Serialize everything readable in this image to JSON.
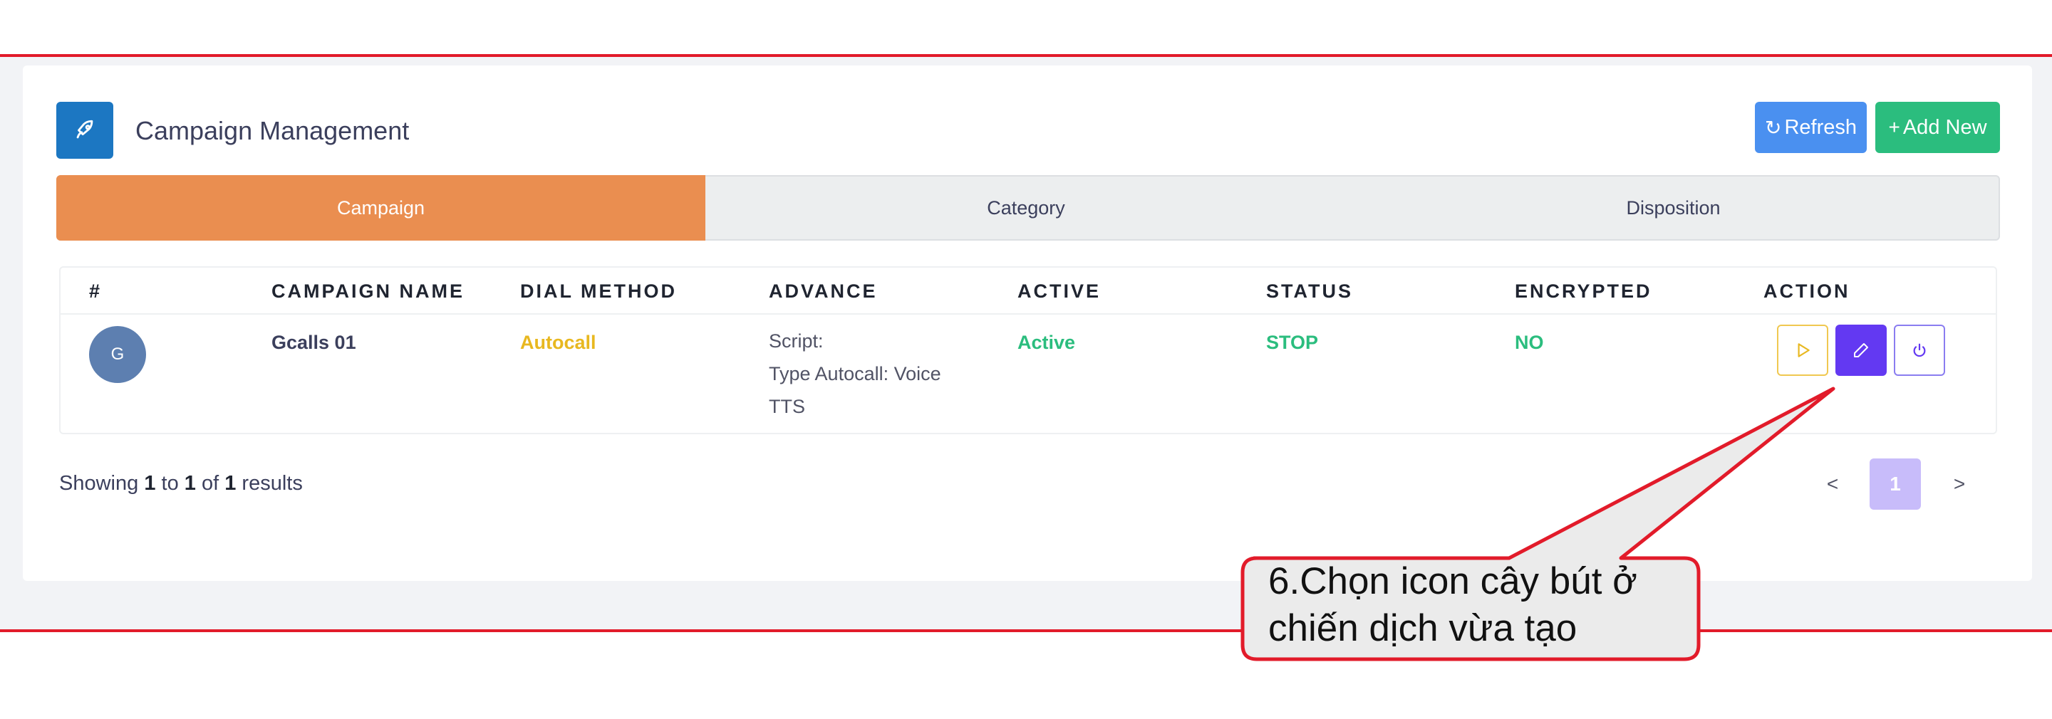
{
  "header": {
    "title": "Campaign Management",
    "title_icon": "rocket-icon",
    "refresh_label": "Refresh",
    "refresh_icon": "refresh-icon",
    "add_new_label": "Add New",
    "add_new_icon": "plus-icon"
  },
  "tabs": [
    {
      "label": "Campaign",
      "active": true
    },
    {
      "label": "Category",
      "active": false
    },
    {
      "label": "Disposition",
      "active": false
    }
  ],
  "table": {
    "columns": [
      "#",
      "CAMPAIGN NAME",
      "DIAL METHOD",
      "ADVANCE",
      "ACTIVE",
      "STATUS",
      "ENCRYPTED",
      "ACTION"
    ],
    "rows": [
      {
        "avatar": "G",
        "name": "Gcalls 01",
        "dial_method": "Autocall",
        "advance": [
          "Script:",
          "Type Autocall: Voice",
          "TTS"
        ],
        "active": "Active",
        "status": "STOP",
        "encrypted": "NO",
        "actions": [
          "play-icon",
          "pencil-icon",
          "power-icon"
        ]
      }
    ]
  },
  "pagination": {
    "prefix": "Showing",
    "from": "1",
    "to_word": "to",
    "to": "1",
    "of_word": "of",
    "total": "1",
    "suffix": "results",
    "prev": "<",
    "current": "1",
    "next": ">"
  },
  "callout": {
    "text": "6.Chọn icon cây bút ở\nchiến dịch vừa tạo"
  },
  "colors": {
    "accent_tab": "#ea8e50",
    "refresh": "#4a90f0",
    "add_new": "#2bbd7e",
    "edit": "#6339f2",
    "frame": "#e21b2a"
  }
}
